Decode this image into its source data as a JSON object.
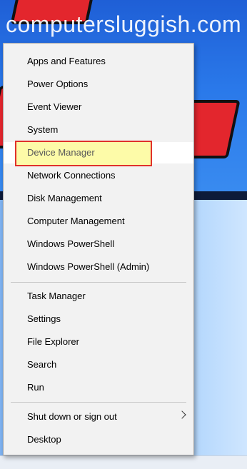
{
  "background": {
    "watermark": "computersluggish.com",
    "accent_red": "#e3262d",
    "accent_blue": "#2a79ea"
  },
  "menu": {
    "items": [
      {
        "label": "Apps and Features"
      },
      {
        "label": "Power Options"
      },
      {
        "label": "Event Viewer"
      },
      {
        "label": "System"
      },
      {
        "label": "Device Manager",
        "highlighted": true
      },
      {
        "label": "Network Connections"
      },
      {
        "label": "Disk Management"
      },
      {
        "label": "Computer Management"
      },
      {
        "label": "Windows PowerShell"
      },
      {
        "label": "Windows PowerShell (Admin)"
      },
      {
        "label": "Task Manager"
      },
      {
        "label": "Settings"
      },
      {
        "label": "File Explorer"
      },
      {
        "label": "Search"
      },
      {
        "label": "Run"
      },
      {
        "label": "Shut down or sign out",
        "submenu_icon": "chevron-right-icon"
      },
      {
        "label": "Desktop"
      }
    ],
    "highlight_color": "#fdfba8",
    "highlight_border": "#e0312b"
  }
}
